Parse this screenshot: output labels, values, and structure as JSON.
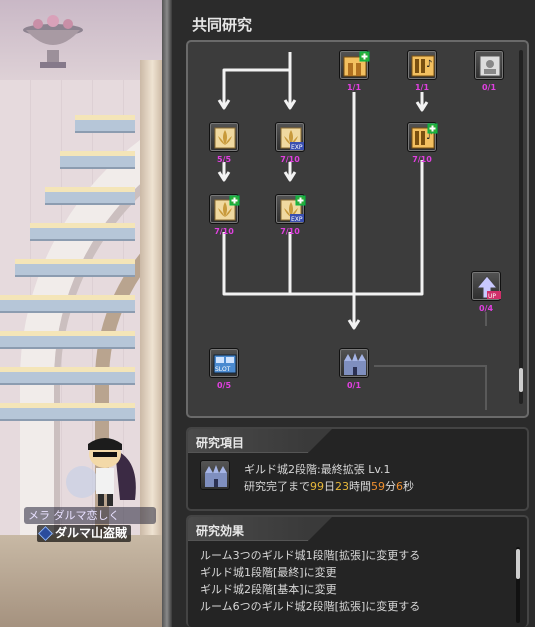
{
  "scene": {
    "guild_tag": "メラ ダルマ恋しく",
    "character_name": "ダルマ山盗賊"
  },
  "window": {
    "title": "共同研究"
  },
  "tree": {
    "nodes": [
      {
        "id": "n-top-center",
        "icon": "guild-castle-expand-icon",
        "count": "1/1"
      },
      {
        "id": "n-top-right",
        "icon": "music-room-icon",
        "count": "1/1"
      },
      {
        "id": "n-top-far",
        "icon": "portrait-board-icon",
        "count": "0/1"
      },
      {
        "id": "n-left-1",
        "icon": "fleur-emblem-icon",
        "count": "5/5"
      },
      {
        "id": "n-left-exp-1",
        "icon": "fleur-exp-icon",
        "count": "7/10"
      },
      {
        "id": "n-right-music-2",
        "icon": "music-room-plus-icon",
        "count": "7/10"
      },
      {
        "id": "n-left-2",
        "icon": "fleur-emblem-plus-icon",
        "count": "7/10"
      },
      {
        "id": "n-left-exp-2",
        "icon": "fleur-exp-plus-icon",
        "count": "7/10"
      },
      {
        "id": "n-upgrade",
        "icon": "upgrade-arrow-icon",
        "count": "0/4"
      },
      {
        "id": "n-slot",
        "icon": "slot-expand-icon",
        "count": "0/5"
      },
      {
        "id": "n-castle",
        "icon": "guild-castle-icon",
        "count": "0/1"
      }
    ]
  },
  "research_item": {
    "header": "研究項目",
    "icon": "guild-castle-icon",
    "name": "ギルド城2段階:最終拡張 Lv.1",
    "time_prefix": "研究完了まで",
    "days": "99",
    "days_unit": "日",
    "hours": "23",
    "hours_unit": "時間",
    "minutes": "59",
    "minutes_unit": "分",
    "seconds": "6",
    "seconds_unit": "秒"
  },
  "research_effect": {
    "header": "研究効果",
    "lines": [
      "ルーム3つのギルド城1段階[拡張]に変更する",
      "ギルド城1段階[最終]に変更",
      "ギルド城2段階[基本]に変更",
      "ルーム6つのギルド城2段階[拡張]に変更する"
    ]
  },
  "colors": {
    "count_text": "#e040e0",
    "timer_highlight": "#e8b83a",
    "connector": "#f2f2f2"
  }
}
